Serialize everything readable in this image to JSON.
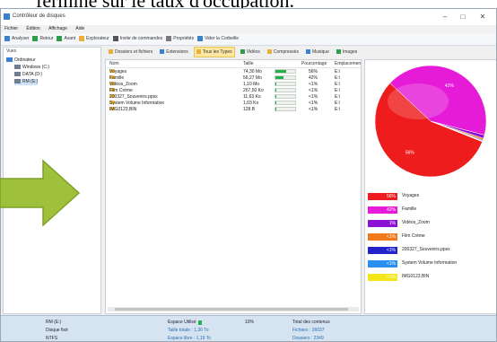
{
  "caption": {
    "text": "fermine sur le taux d'occupation."
  },
  "window": {
    "title": "Contrôleur de disques",
    "controls": {
      "minimize": "–",
      "maximize": "□",
      "close": "✕"
    },
    "menu": [
      "Fichier",
      "Édition",
      "Affichage",
      "Aide"
    ],
    "toolbar": [
      {
        "label": "Analyser",
        "icon": "analyze-icon",
        "color": "#3a82d0"
      },
      {
        "label": "Retour",
        "icon": "back-icon",
        "color": "#2e9e4a"
      },
      {
        "label": "Avant",
        "icon": "forward-icon",
        "color": "#2e9e4a"
      },
      {
        "label": "Explorateur",
        "icon": "folder-icon",
        "color": "#e8b03a"
      },
      {
        "label": "Invite de commandes",
        "icon": "console-icon",
        "color": "#555555"
      },
      {
        "label": "Propriétés",
        "icon": "properties-icon",
        "color": "#7a7a7a"
      },
      {
        "label": "Vider la Corbeille",
        "icon": "recycle-icon",
        "color": "#3a82d0"
      }
    ]
  },
  "tree": {
    "header": "Vues",
    "items": [
      {
        "label": "Ordinateur",
        "indent": 0,
        "selected": false
      },
      {
        "label": "Windows (C:)",
        "indent": 1,
        "selected": false
      },
      {
        "label": "DATA (D:)",
        "indent": 1,
        "selected": false
      },
      {
        "label": "RM (E:)",
        "indent": 1,
        "selected": true
      }
    ]
  },
  "view_toolbar": [
    {
      "label": "Dossiers et fichiers",
      "active": false
    },
    {
      "label": "Extensions",
      "active": false
    },
    {
      "label": "Tous les Types",
      "active": true
    },
    {
      "label": "Vidéos",
      "active": false
    },
    {
      "label": "Compressés",
      "active": false
    },
    {
      "label": "Musique",
      "active": false
    },
    {
      "label": "Images",
      "active": false
    }
  ],
  "list": {
    "columns": {
      "name": "Nom",
      "size": "Taille",
      "percent": "Pourcentage",
      "location": "Emplacement"
    },
    "rows": [
      {
        "name": "Voyages",
        "size": "74,30 Mo",
        "pct": 56,
        "pct_label": "56%",
        "loc": "E:\\"
      },
      {
        "name": "Famille",
        "size": "56,27 Mo",
        "pct": 42,
        "pct_label": "42%",
        "loc": "E:\\"
      },
      {
        "name": "Vidéos_Zoom",
        "size": "1,10 Mo",
        "pct": 1,
        "pct_label": "<1%",
        "loc": "E:\\"
      },
      {
        "name": "Film Crème",
        "size": "267,50 Ko",
        "pct": 1,
        "pct_label": "<1%",
        "loc": "E:\\"
      },
      {
        "name": "200327_Souvenirs.ppsx",
        "size": "11,63 Ko",
        "pct": 1,
        "pct_label": "<1%",
        "loc": "E:\\"
      },
      {
        "name": "System Volume Information",
        "size": "1,03 Ko",
        "pct": 1,
        "pct_label": "<1%",
        "loc": "E:\\"
      },
      {
        "name": "IMG0123.BIN",
        "size": "128 B",
        "pct": 1,
        "pct_label": "<1%",
        "loc": "E:\\"
      }
    ]
  },
  "chart_data": {
    "type": "pie",
    "series": [
      {
        "label": "Voyages",
        "value": 56,
        "color": "#ee1c1c"
      },
      {
        "label": "Famille",
        "value": 42,
        "color": "#e61bd8"
      },
      {
        "label": "Vidéos_Zoom",
        "value": 1,
        "color": "#8b12d4"
      },
      {
        "label": "Film Crème",
        "value": 0.5,
        "color": "#f07a1e"
      },
      {
        "label": "200327_Souvenirs.ppsx",
        "value": 0.25,
        "color": "#2323cc"
      },
      {
        "label": "System Volume Information",
        "value": 0.15,
        "color": "#2a8ff0"
      },
      {
        "label": "IMG0123.BIN",
        "value": 0.1,
        "color": "#f5e61a"
      }
    ],
    "slice_labels": [
      "56%",
      "42%"
    ]
  },
  "legend": [
    {
      "label": "Voyages",
      "pct": "56%",
      "color": "#ee1c1c"
    },
    {
      "label": "Famille",
      "pct": "42%",
      "color": "#e61bd8"
    },
    {
      "label": "Vidéos_Zoom",
      "pct": "1%",
      "color": "#8b12d4"
    },
    {
      "label": "Film Crème",
      "pct": "<1%",
      "color": "#f07a1e"
    },
    {
      "label": "200327_Souvenirs.ppsx",
      "pct": "<1%",
      "color": "#2323cc"
    },
    {
      "label": "System Volume Information",
      "pct": "<1%",
      "color": "#2a8ff0"
    },
    {
      "label": "IMG0123.BIN",
      "pct": "<1%",
      "color": "#f5e61a"
    }
  ],
  "status": {
    "drive": "RM (E:)",
    "type": "Disque fixé",
    "fs": "NTFS",
    "used_label": "Espace Utilisé",
    "used_pct_value": 10,
    "used_pct": "10%",
    "total_size": "Taille totale : 1,30 To",
    "free_space": "Espace libre : 1,19 To",
    "content_title": "Total des contenus",
    "files": "Fichiers : 26037",
    "folders": "Dossiers : 2349"
  },
  "arrow": {
    "color": "#9ec03a"
  }
}
